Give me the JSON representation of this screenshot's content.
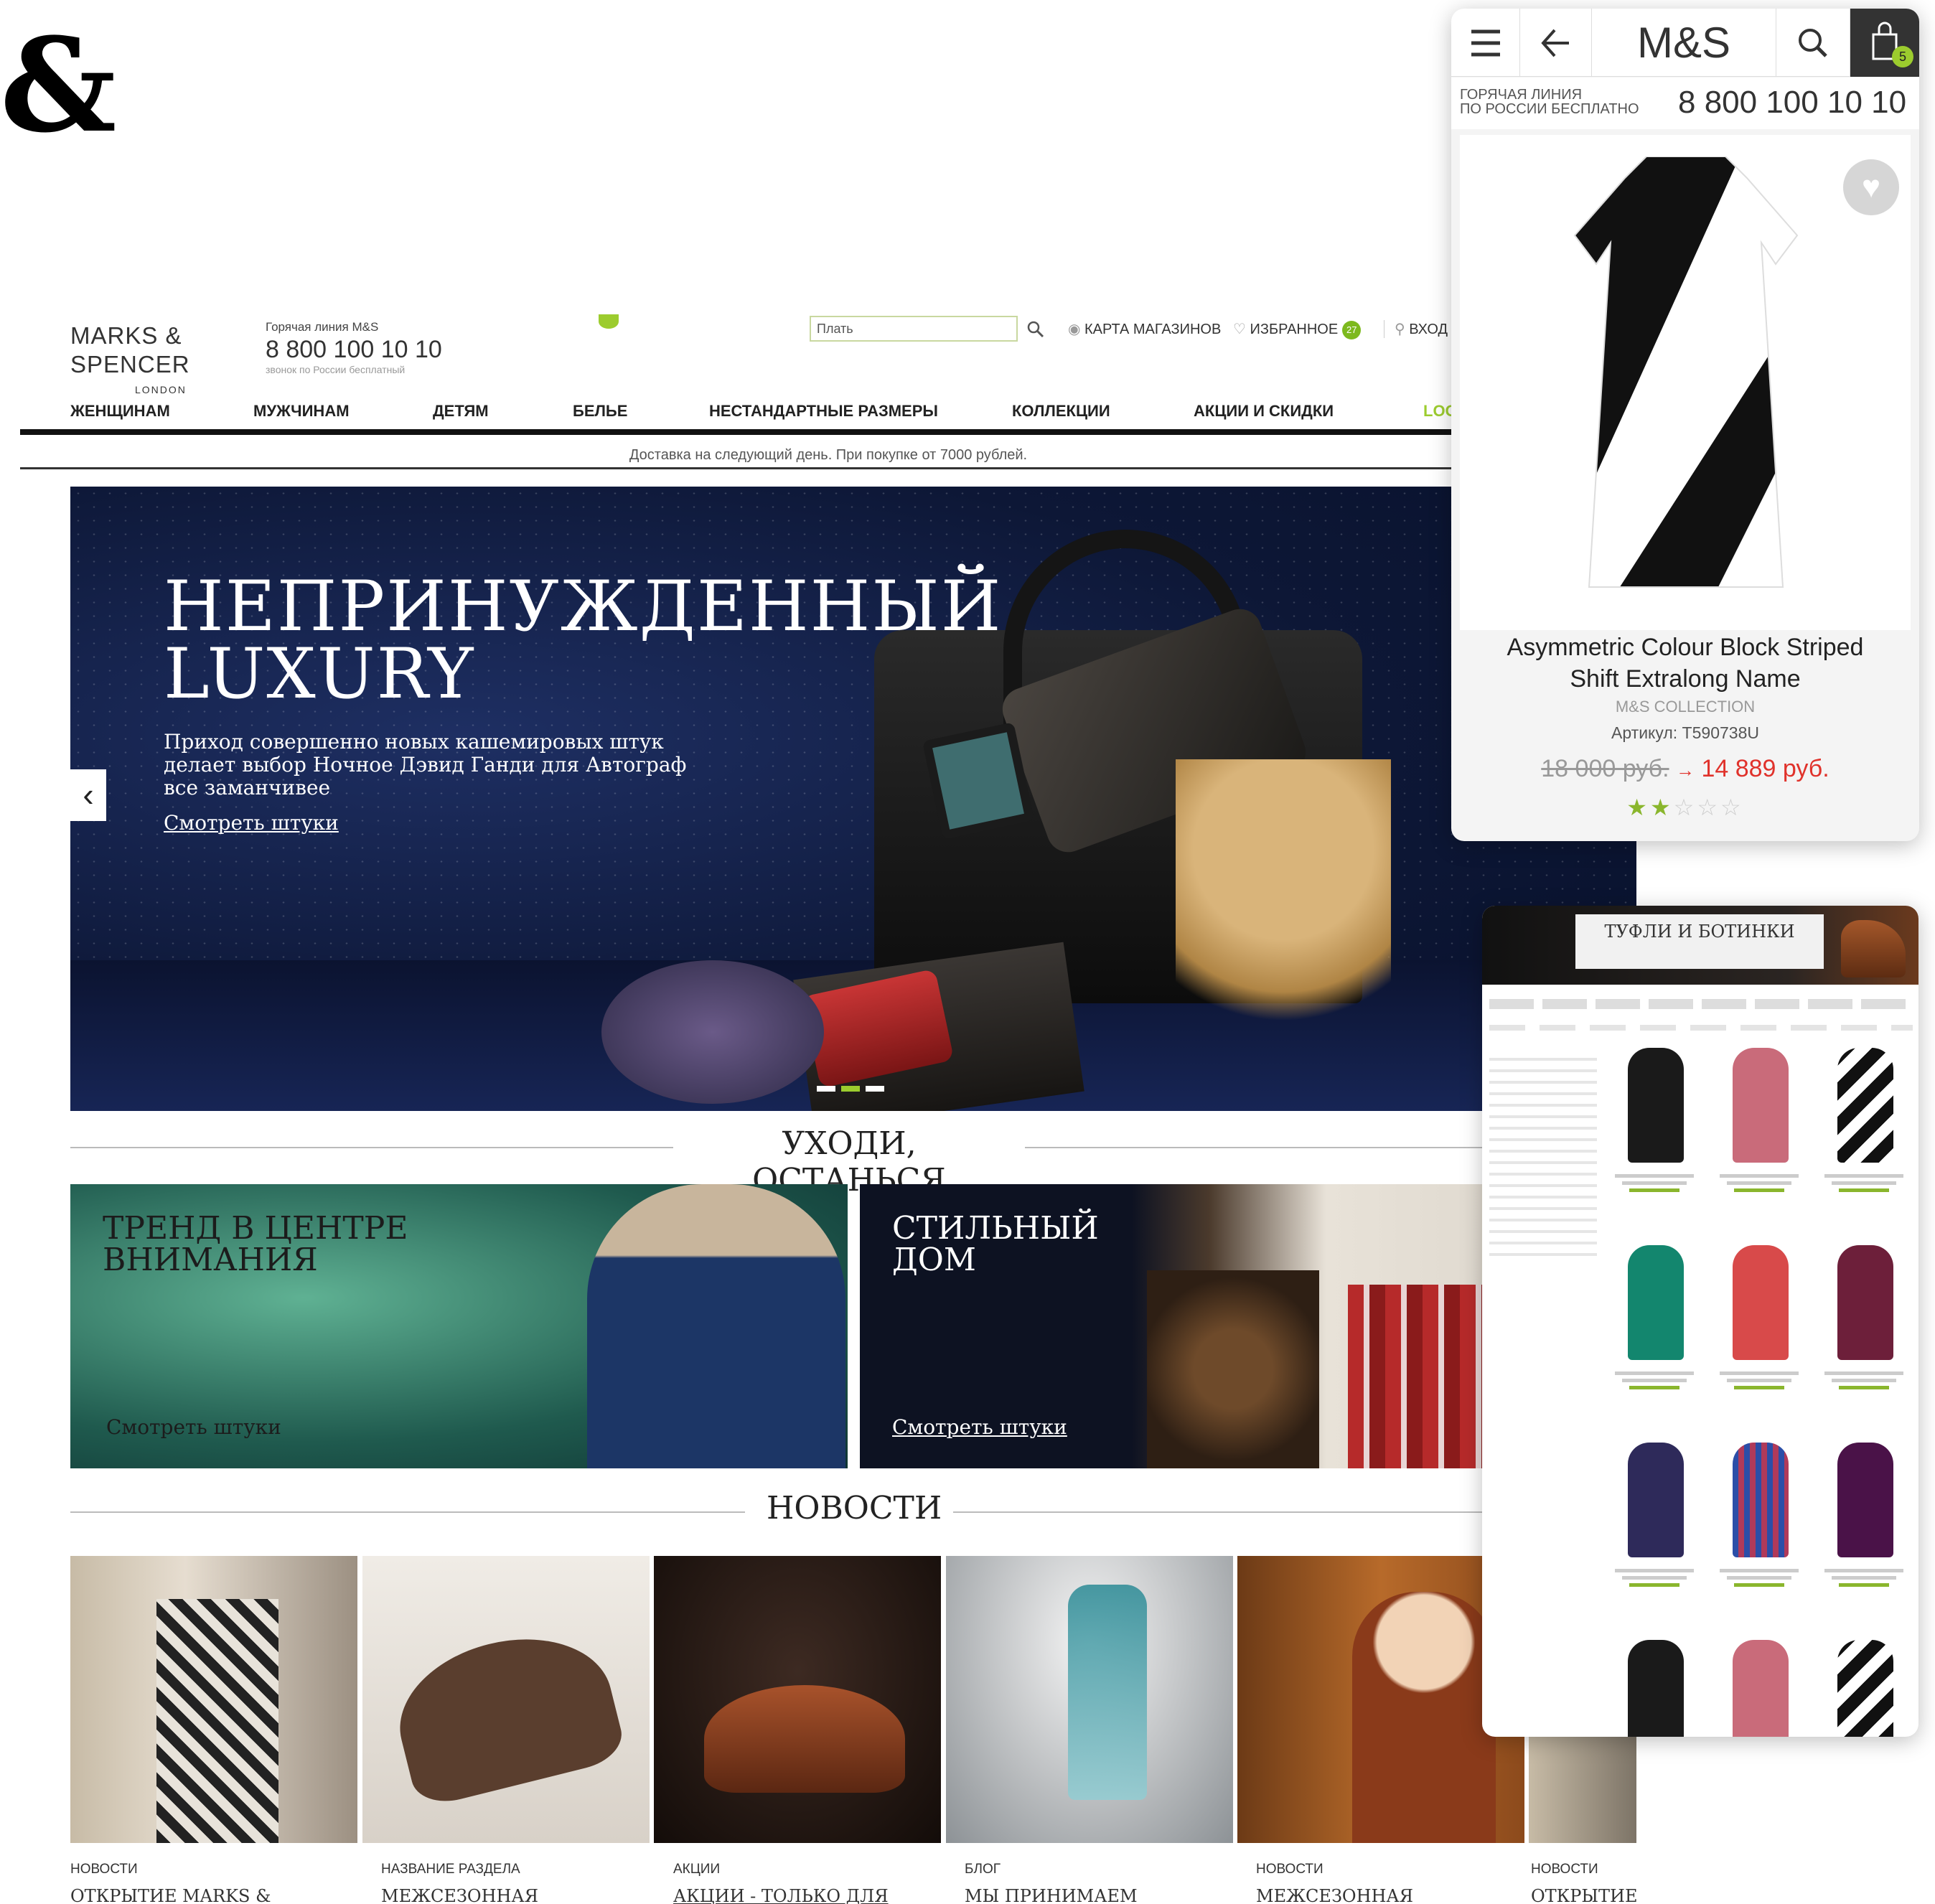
{
  "brand_glyph": "&",
  "site": {
    "logo": {
      "line1": "MARKS &",
      "line2": "SPENCER",
      "line3": "LONDON"
    },
    "hotline": {
      "label": "Горячая линия M&S",
      "phone": "8 800 100 10 10",
      "note": "звонок по России бесплатный"
    },
    "search": {
      "value": "Плать"
    },
    "utility": {
      "stores": "КАРТА МАГАЗИНОВ",
      "favorites": "ИЗБРАННОЕ",
      "favorites_count": "27",
      "login": "ВХОД"
    },
    "nav": [
      "ЖЕНЩИНАМ",
      "МУЖЧИНАМ",
      "ДЕТЯМ",
      "БЕЛЬЕ",
      "НЕСТАНДАРТНЫЕ РАЗМЕРЫ",
      "КОЛЛЕКЦИИ",
      "АКЦИИ И СКИДКИ",
      "LOO"
    ],
    "delivery": "Доставка на следующий день. При покупке от 7000 рублей.",
    "hero": {
      "title_line1": "НЕПРИНУЖДЕННЫЙ",
      "title_line2": "LUXURY",
      "subtitle": "Приход совершенно новых кашемировых штук делает выбор Ночное Дэвид Ганди для Автограф все заманчивее",
      "link": "Смотреть штуки",
      "prev": "‹"
    },
    "section1": "УХОДИ, ОСТАНЬСЯ",
    "promo_left": {
      "title_line1": "ТРЕНД В ЦЕНТРЕ",
      "title_line2": "ВНИМАНИЯ",
      "link": "Смотреть штуки"
    },
    "promo_right": {
      "title_line1": "СТИЛЬНЫЙ",
      "title_line2": "ДОМ",
      "link": "Смотреть штуки"
    },
    "section2": "НОВОСТИ",
    "news": [
      {
        "category": "НОВОСТИ",
        "title": "ОТКРЫТИЕ MARKS &"
      },
      {
        "category": "НАЗВАНИЕ РАЗДЕЛА",
        "title": "МЕЖСЕЗОННАЯ"
      },
      {
        "category": "АКЦИИ",
        "title": "АКЦИИ - ТОЛЬКО ДЛЯ"
      },
      {
        "category": "БЛОГ",
        "title": "МЫ ПРИНИМАЕМ"
      },
      {
        "category": "НОВОСТИ",
        "title": "МЕЖСЕЗОННАЯ"
      },
      {
        "category": "НОВОСТИ",
        "title": "ОТКРЫТИЕ M"
      }
    ]
  },
  "mobile": {
    "brand": "M&S",
    "cart_count": "5",
    "hotline_label1": "ГОРЯЧАЯ ЛИНИЯ",
    "hotline_label2": "ПО РОССИИ БЕСПЛАТНО",
    "phone": "8 800 100 10 10",
    "product": {
      "name_line1": "Asymmetric Colour Block Striped",
      "name_line2": "Shift Extralong Name",
      "brand": "M&S COLLECTION",
      "sku": "Артикул: T590738U",
      "old_price": "18 000 руб.",
      "arrow": "→",
      "new_price": "14 889 руб.",
      "rating": 2,
      "rating_max": 5
    }
  },
  "catalog": {
    "banner": "ТУФЛИ И БОТИНКИ"
  },
  "colors": {
    "accent_green": "#7db91e",
    "price_red": "#e0322b",
    "star_green": "#8ab62d"
  }
}
